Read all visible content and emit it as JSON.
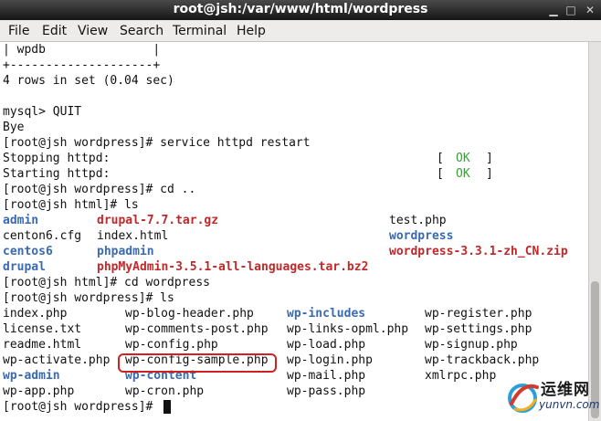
{
  "window": {
    "title": "root@jsh:/var/www/html/wordpress",
    "min_glyph": "▁",
    "max_glyph": "□",
    "close_glyph": "✕"
  },
  "menu": [
    "File",
    "Edit",
    "View",
    "Search",
    "Terminal",
    "Help"
  ],
  "terminal": {
    "lines": [
      "| wpdb               |",
      "+--------------------+",
      "4 rows in set (0.04 sec)",
      "",
      "mysql> QUIT",
      "Bye",
      "[root@jsh wordpress]# service httpd restart",
      "[root@jsh wordpress]# cd ..",
      "[root@jsh html]# ls",
      "[root@jsh html]# cd wordpress",
      "[root@jsh wordpress]# ls",
      "[root@jsh wordpress]# "
    ],
    "status_lines": [
      {
        "text": "Stopping httpd:",
        "open": "[",
        "status": "OK",
        "close": "]"
      },
      {
        "text": "Starting httpd:",
        "open": "[",
        "status": "OK",
        "close": "]"
      }
    ],
    "status_color": "#3aa03a",
    "html_listing": [
      [
        "admin",
        "drupal-7.7.tar.gz",
        "test.php"
      ],
      [
        "centon6.cfg",
        "index.html",
        "wordpress"
      ],
      [
        "centos6",
        "phpadmin",
        "wordpress-3.3.1-zh_CN.zip"
      ],
      [
        "drupal",
        "phpMyAdmin-3.5.1-all-languages.tar.bz2",
        ""
      ]
    ],
    "wordpress_listing": [
      [
        "index.php",
        "wp-blog-header.php",
        "wp-includes",
        "wp-register.php"
      ],
      [
        "license.txt",
        "wp-comments-post.php",
        "wp-links-opml.php",
        "wp-settings.php"
      ],
      [
        "readme.html",
        "wp-config.php",
        "wp-load.php",
        "wp-signup.php"
      ],
      [
        "wp-activate.php",
        "wp-config-sample.php",
        "wp-login.php",
        "wp-trackback.php"
      ],
      [
        "wp-admin",
        "wp-content",
        "wp-mail.php",
        "xmlrpc.php"
      ],
      [
        "wp-app.php",
        "wp-cron.php",
        "wp-pass.php",
        ""
      ]
    ],
    "highlighted_file": "wp-config-sample.php",
    "colors": {
      "directory": "#3a6ab0",
      "archive": "#c0282a",
      "highlight_ring": "#d02222"
    }
  },
  "watermark": {
    "text_1": "运维网",
    "text_2": "yunvn.com"
  }
}
